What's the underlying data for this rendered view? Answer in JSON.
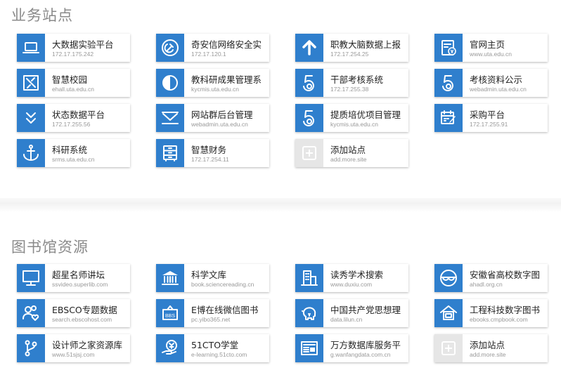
{
  "sections": [
    {
      "title": "业务站点",
      "cards": [
        {
          "name": "大数据实验平台",
          "url": "172.17.175.242",
          "icon": "laptop-icon"
        },
        {
          "name": "奇安信网络安全实",
          "url": "172.17.120.1",
          "icon": "hammer-sickle-icon"
        },
        {
          "name": "职教大脑数据上报",
          "url": "172.17.254.25",
          "icon": "arrow-up-icon"
        },
        {
          "name": "官网主页",
          "url": "www.uta.edu.cn",
          "icon": "invoice-icon"
        },
        {
          "name": "智慧校园",
          "url": "ehall.uta.edu.cn",
          "icon": "tools-icon"
        },
        {
          "name": "教科研成果管理系",
          "url": "kycmis.uta.edu.cn",
          "icon": "half-circle-icon"
        },
        {
          "name": "干部考核系统",
          "url": "172.17.255.38",
          "icon": "number-five-icon"
        },
        {
          "name": "考核资料公示",
          "url": "webadmin.uta.edu.cn",
          "icon": "number-five-icon"
        },
        {
          "name": "状态数据平台",
          "url": "172.17.255.56",
          "icon": "double-chevron-down-icon"
        },
        {
          "name": "网站群后台管理",
          "url": "webadmin.uta.edu.cn",
          "icon": "envelope-icon"
        },
        {
          "name": "提质培优项目管理",
          "url": "kycmis.uta.edu.cn",
          "icon": "number-five-icon"
        },
        {
          "name": "采购平台",
          "url": "172.17.255.91",
          "icon": "calendar-pen-icon"
        },
        {
          "name": "科研系统",
          "url": "srms.uta.edu.cn",
          "icon": "anchor-icon"
        },
        {
          "name": "智慧财务",
          "url": "172.17.254.11",
          "icon": "cabinet-icon"
        },
        {
          "name": "添加站点",
          "url": "add.more.site",
          "icon": "add-icon"
        }
      ]
    },
    {
      "title": "图书馆资源",
      "cards": [
        {
          "name": "超星名师讲坛",
          "url": "ssvideo.superlib.com",
          "icon": "monitor-icon"
        },
        {
          "name": "科学文库",
          "url": "book.sciencereading.cn",
          "icon": "museum-icon"
        },
        {
          "name": "读秀学术搜索",
          "url": "www.duxiu.com",
          "icon": "building-icon"
        },
        {
          "name": "安徽省高校数字图",
          "url": "ahadl.org.cn",
          "icon": "glasses-icon"
        },
        {
          "name": "EBSCO专题数据",
          "url": "search.ebscohost.com",
          "icon": "users-heart-icon"
        },
        {
          "name": "E博在线微信图书",
          "url": "pc.yibo365.net",
          "icon": "bbs-sign-icon"
        },
        {
          "name": "中国共产党思想理",
          "url": "data.lilun.cn",
          "icon": "piggy-bank-icon"
        },
        {
          "name": "工程科技数字图书",
          "url": "ebooks.cmpbook.com",
          "icon": "house-screen-icon"
        },
        {
          "name": "设计师之家资源库",
          "url": "www.51sjsj.com",
          "icon": "branch-icon"
        },
        {
          "name": "51CTO学堂",
          "url": "e-learning.51cto.com",
          "icon": "hand-money-icon"
        },
        {
          "name": "万方数据库服务平",
          "url": "g.wanfangdata.com.cn",
          "icon": "newspaper-icon"
        },
        {
          "name": "添加站点",
          "url": "add.more.site",
          "icon": "add-icon"
        }
      ]
    }
  ],
  "colors": {
    "icon_bg": "#2f7fcd",
    "add_icon_bg": "#e6e6e6",
    "title": "#8a8a8a"
  }
}
